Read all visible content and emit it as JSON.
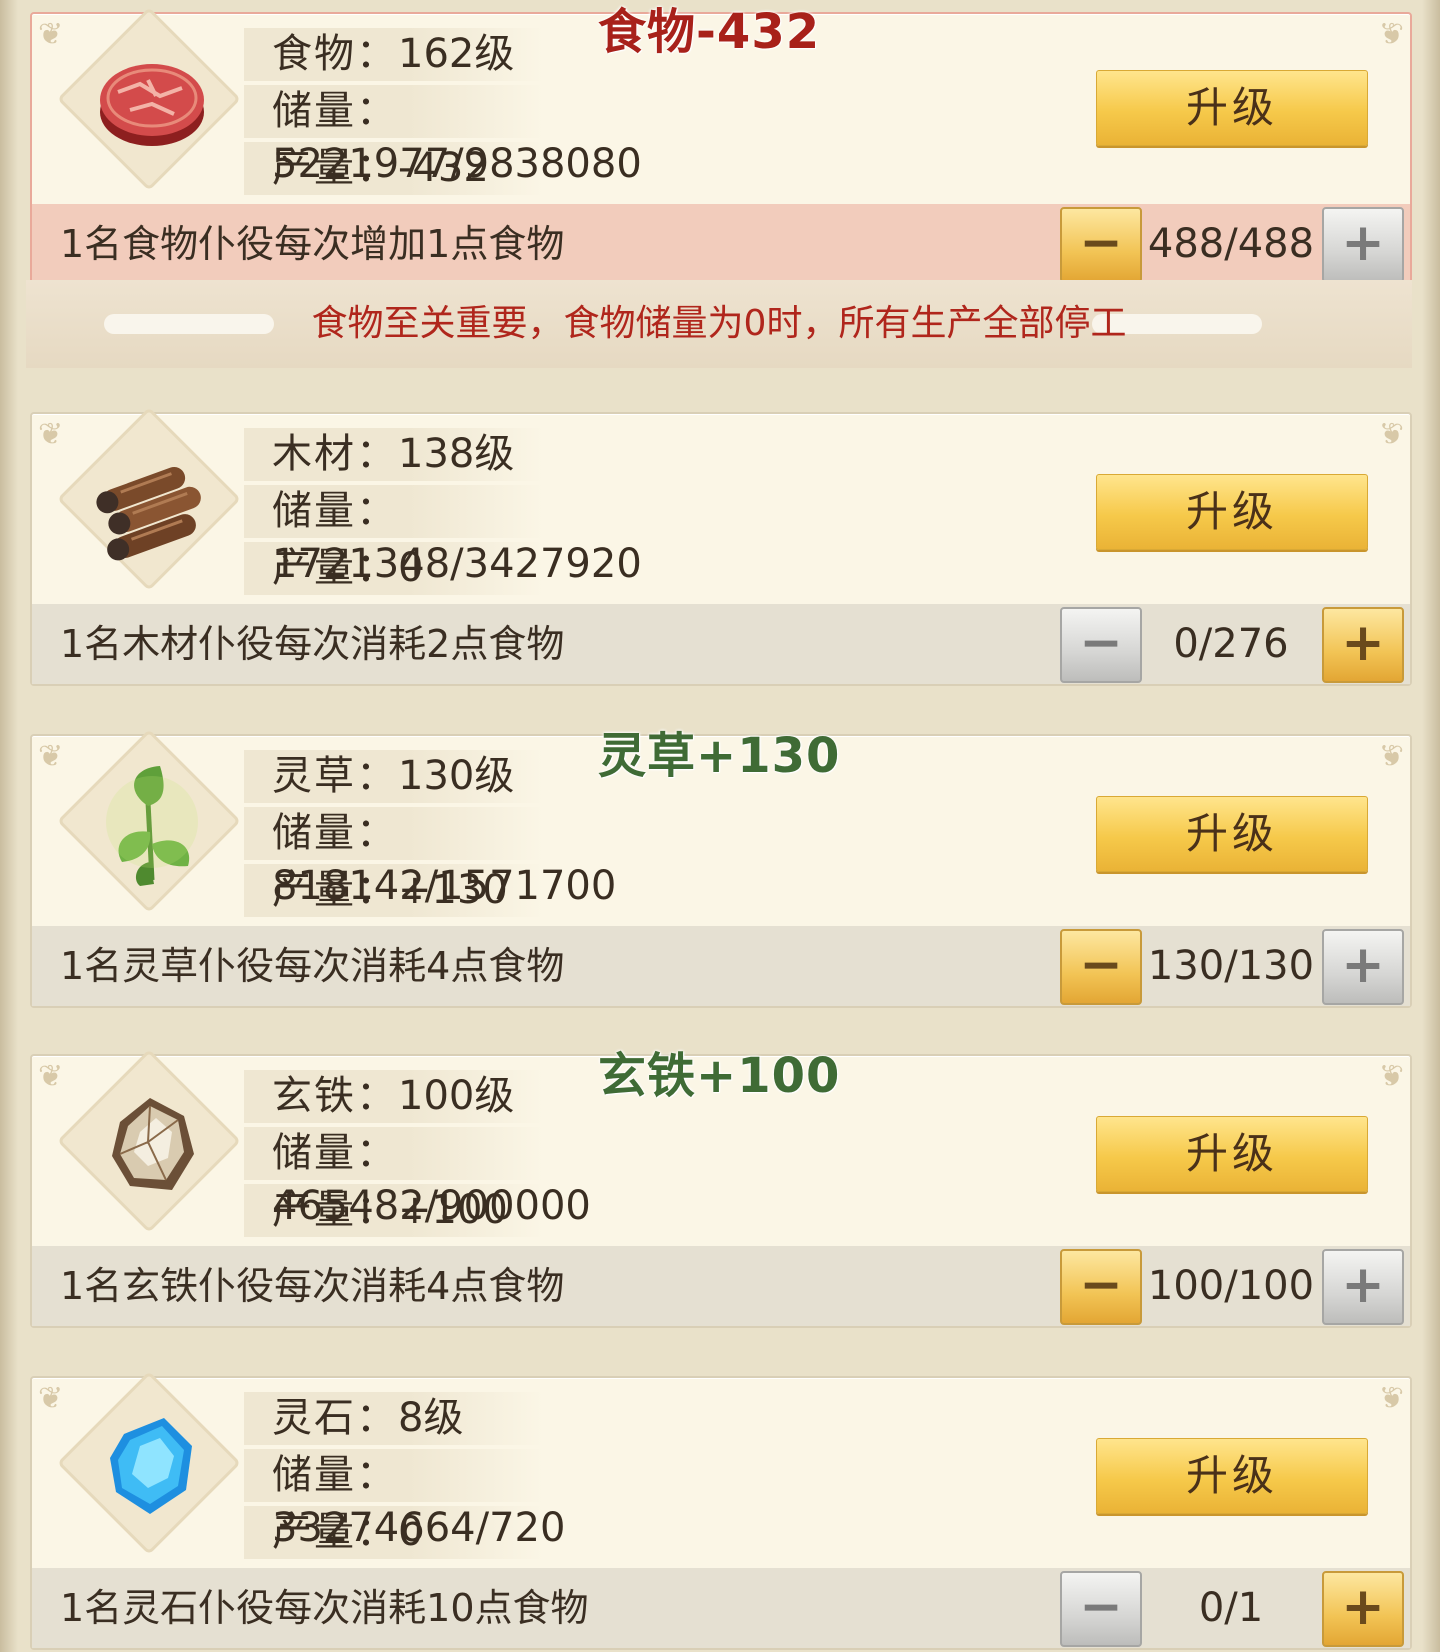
{
  "float_labels": {
    "food": "食物-432",
    "herb": "灵草+130",
    "iron": "玄铁+100"
  },
  "warning": "食物至关重要，食物储量为0时，所有生产全部停工",
  "colors": {
    "food_float": "#a8211a",
    "green_float": "#3f6b35",
    "warning": "#b0261c",
    "upgrade_button": "#f6c94a"
  },
  "resources": [
    {
      "icon": "meat-icon",
      "title_label": "食物：",
      "title_value": "162级",
      "storage_label": "储量：",
      "storage_value": "5221977/9838080",
      "output_label": "产量：",
      "output_value": "-432",
      "upgrade": "升级",
      "desc": "1名食物仆役每次增加1点食物",
      "minus": "−",
      "count": "488/488",
      "plus": "+"
    },
    {
      "icon": "wood-logs-icon",
      "title_label": "木材：",
      "title_value": "138级",
      "storage_label": "储量：",
      "storage_value": "1721348/3427920",
      "output_label": "产量：",
      "output_value": "0",
      "upgrade": "升级",
      "desc": "1名木材仆役每次消耗2点食物",
      "minus": "−",
      "count": "0/276",
      "plus": "+"
    },
    {
      "icon": "herb-leaf-icon",
      "title_label": "灵草：",
      "title_value": "130级",
      "storage_label": "储量：",
      "storage_value": "818142/1571700",
      "output_label": "产量：",
      "output_value": "+130",
      "upgrade": "升级",
      "desc": "1名灵草仆役每次消耗4点食物",
      "minus": "−",
      "count": "130/130",
      "plus": "+"
    },
    {
      "icon": "iron-ore-icon",
      "title_label": "玄铁：",
      "title_value": "100级",
      "storage_label": "储量：",
      "storage_value": "465482/900000",
      "output_label": "产量：",
      "output_value": "+100",
      "upgrade": "升级",
      "desc": "1名玄铁仆役每次消耗4点食物",
      "minus": "−",
      "count": "100/100",
      "plus": "+"
    },
    {
      "icon": "spirit-stone-icon",
      "title_label": "灵石：",
      "title_value": "8级",
      "storage_label": "储量：",
      "storage_value": "33274664/720",
      "output_label": "产量：",
      "output_value": "0",
      "upgrade": "升级",
      "desc": "1名灵石仆役每次消耗10点食物",
      "minus": "−",
      "count": "0/1",
      "plus": "+"
    }
  ]
}
